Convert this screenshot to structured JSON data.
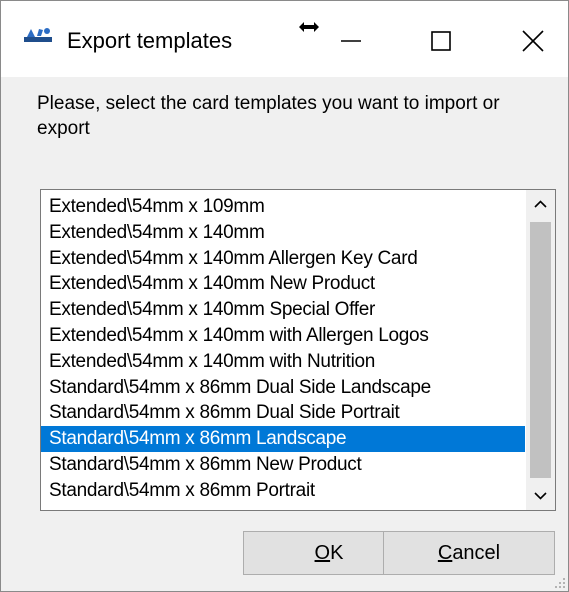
{
  "window": {
    "title": "Export templates"
  },
  "prompt": "Please, select the card templates you want to import or export",
  "templates": [
    "Extended\\54mm x 109mm",
    "Extended\\54mm x 140mm",
    "Extended\\54mm x 140mm Allergen Key Card",
    "Extended\\54mm x 140mm New Product",
    "Extended\\54mm x 140mm Special Offer",
    "Extended\\54mm x 140mm with Allergen Logos",
    "Extended\\54mm x 140mm with Nutrition",
    "Standard\\54mm x 86mm Dual Side Landscape",
    "Standard\\54mm x 86mm Dual Side Portrait",
    "Standard\\54mm x 86mm Landscape",
    "Standard\\54mm x 86mm New Product",
    "Standard\\54mm x 86mm Portrait"
  ],
  "selected_template": "Standard\\54mm x 86mm Landscape",
  "buttons": {
    "ok": {
      "mnemonic": "O",
      "rest": "K"
    },
    "cancel": {
      "mnemonic": "C",
      "rest": "ancel"
    }
  },
  "icons": {
    "app": "card-template-icon",
    "resize": "resize-horizontal-icon",
    "minimize": "minimize-icon",
    "maximize": "maximize-icon",
    "close": "close-icon",
    "scroll_up": "chevron-up-icon",
    "scroll_down": "chevron-down-icon"
  },
  "colors": {
    "selection": "#0078d7",
    "dialog_bg": "#f0f0f0",
    "button_bg": "#e1e1e1"
  }
}
